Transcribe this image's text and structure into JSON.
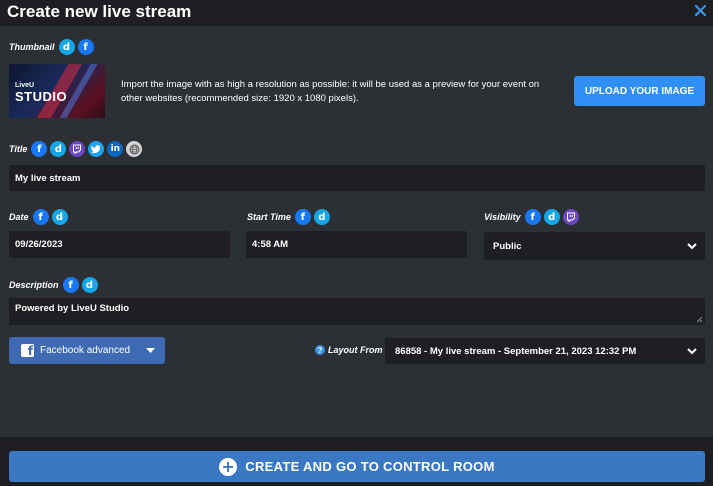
{
  "window": {
    "title": "Create new live stream"
  },
  "thumbnail": {
    "label": "Thumbnail",
    "preview_line1": "LiveU",
    "preview_line2": "STUDIO",
    "description": "Import the image with as high a resolution as possible: it will be used as a preview for your event on other websites (recommended size: 1920 x 1080 pixels).",
    "upload_label": "UPLOAD YOUR IMAGE"
  },
  "title_field": {
    "label": "Title",
    "value": "My live stream"
  },
  "date_field": {
    "label": "Date",
    "value": "09/26/2023"
  },
  "start_time_field": {
    "label": "Start Time",
    "value": "4:58 AM"
  },
  "visibility_field": {
    "label": "Visibility",
    "value": "Public"
  },
  "description_field": {
    "label": "Description",
    "value": "Powered by LiveU Studio"
  },
  "facebook_advanced": {
    "label": "Facebook advanced"
  },
  "layout_from": {
    "help_glyph": "?",
    "label": "Layout From",
    "value": "86858 - My live stream - September 21, 2023 12:32 PM"
  },
  "create_button": {
    "label": "CREATE AND GO TO CONTROL ROOM"
  },
  "icons": {
    "facebook": "f",
    "dailymotion": "d",
    "linkedin": "in",
    "plus": "+"
  },
  "colors": {
    "background": "#2c2f33",
    "panel_dark": "#1d1f23",
    "accent_blue": "#2f8ff5",
    "create_button": "#3a78c3",
    "facebook_button": "#3d6ab3"
  }
}
